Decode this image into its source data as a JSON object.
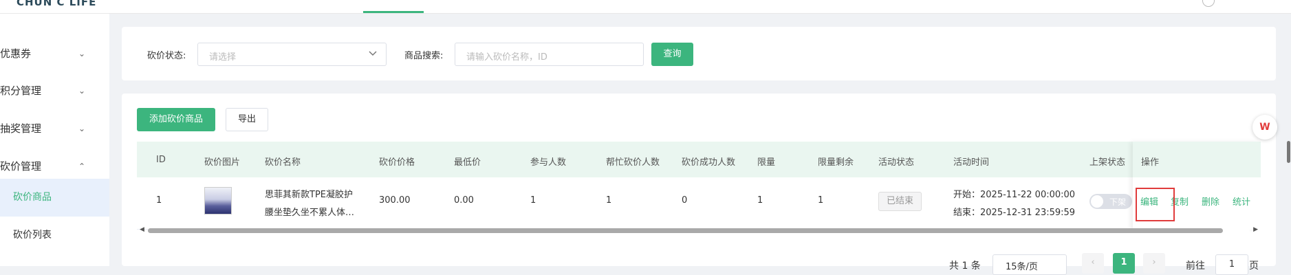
{
  "header": {
    "logo": "CHUN C LIFE"
  },
  "sidebar": {
    "menus": [
      {
        "label": "优惠券",
        "chevron": "⌄"
      },
      {
        "label": "积分管理",
        "chevron": "⌄"
      },
      {
        "label": "抽奖管理",
        "chevron": "⌄"
      },
      {
        "label": "砍价管理",
        "chevron": "⌃"
      }
    ],
    "submenu": [
      {
        "label": "砍价商品",
        "active": true
      },
      {
        "label": "砍价列表",
        "active": false
      }
    ]
  },
  "filters": {
    "status_label": "砍价状态:",
    "status_placeholder": "请选择",
    "search_label": "商品搜索:",
    "search_placeholder": "请输入砍价名称，ID",
    "query_button": "查询"
  },
  "toolbar": {
    "add_button": "添加砍价商品",
    "export_button": "导出"
  },
  "table": {
    "columns": [
      "ID",
      "砍价图片",
      "砍价名称",
      "砍价价格",
      "最低价",
      "参与人数",
      "帮忙砍价人数",
      "砍价成功人数",
      "限量",
      "限量剩余",
      "活动状态",
      "活动时间",
      "上架状态",
      "操作"
    ],
    "rows": [
      {
        "id": "1",
        "name_line1": "思菲其新款TPE凝胶护",
        "name_line2": "腰坐垫久坐不累人体…",
        "price": "300.00",
        "min_price": "0.00",
        "participants": "1",
        "helpers": "1",
        "success": "0",
        "limit": "1",
        "remaining": "1",
        "status": "已结束",
        "start": "开始：2025-11-22 00:00:00",
        "end": "结束：2025-12-31 23:59:59",
        "shelf_text": "下架",
        "actions": [
          "编辑",
          "复制",
          "删除",
          "统计"
        ]
      }
    ]
  },
  "pagination": {
    "total": "共 1 条",
    "page_size": "15条/页",
    "prev": "‹",
    "current": "1",
    "next": "›",
    "goto_label": "前往",
    "goto_value": "1",
    "page_suffix": "页"
  },
  "floating": {
    "wps_label": "W"
  },
  "colors": {
    "accent": "#3cb57e",
    "highlight": "#e03b3b"
  }
}
